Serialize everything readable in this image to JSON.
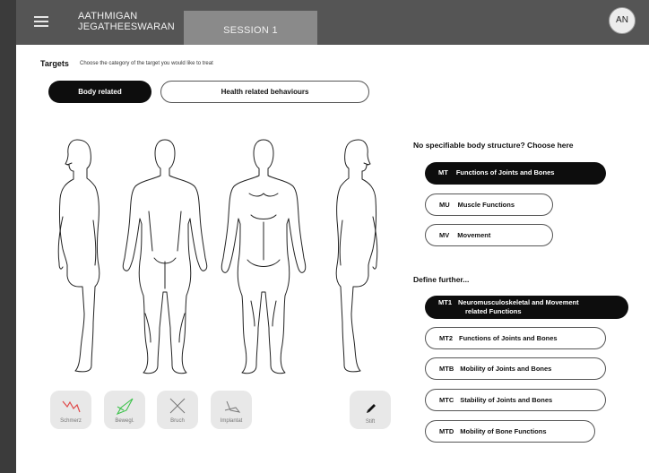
{
  "header": {
    "user_name_line1": "AATHMIGAN",
    "user_name_line2": "JEGATHEESWARAN",
    "session_tab": "SESSION 1",
    "avatar_initials": "AN"
  },
  "targets": {
    "label": "Targets",
    "description": "Choose the category of the target you would like to treat"
  },
  "category_tabs": {
    "body_related": "Body related",
    "health_behaviours": "Health related behaviours"
  },
  "tools": {
    "schmerz": "Schmerz",
    "bewegl": "Bewegl.",
    "bruch": "Bruch",
    "implantat": "Implantat",
    "stift": "Stift"
  },
  "no_structure": {
    "title": "No specifiable body structure? Choose here",
    "items": [
      {
        "code": "MT",
        "label": "Functions of Joints and Bones",
        "selected": true
      },
      {
        "code": "MU",
        "label": "Muscle Functions",
        "selected": false
      },
      {
        "code": "MV",
        "label": "Movement",
        "selected": false
      }
    ]
  },
  "define_further": {
    "title": "Define further...",
    "items": [
      {
        "code": "MT1",
        "label": "Neuromusculoskeletal and Movement",
        "label2": "related Functions",
        "selected": true
      },
      {
        "code": "MT2",
        "label": "Functions of Joints and Bones",
        "selected": false
      },
      {
        "code": "MTB",
        "label": "Mobility of Joints and Bones",
        "selected": false
      },
      {
        "code": "MTC",
        "label": "Stability of Joints and Bones",
        "selected": false
      },
      {
        "code": "MTD",
        "label": "Mobility of Bone Functions",
        "selected": false
      }
    ]
  },
  "colors": {
    "schmerz_icon": "#e04848",
    "bewegl_icon": "#3cc24a",
    "selected_pill": "#0d0d0d",
    "header_bg": "#555555",
    "session_tab_bg": "#8a8a8a"
  }
}
